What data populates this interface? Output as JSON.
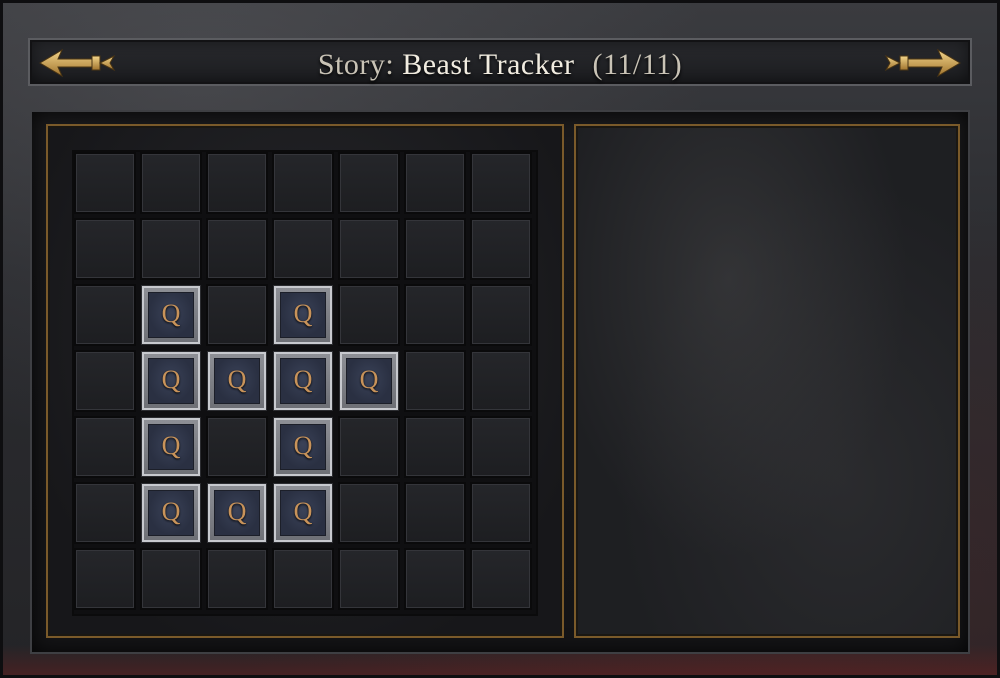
{
  "header": {
    "title_prefix": "Story:",
    "title_name": "Beast Tracker",
    "title_count": "(11/11)",
    "prev_icon": "ornate-arrow-left-icon",
    "next_icon": "ornate-arrow-right-icon"
  },
  "grid": {
    "rows": 7,
    "cols": 7,
    "quest_glyph": "Q",
    "filled_cells": [
      [
        2,
        1
      ],
      [
        2,
        3
      ],
      [
        3,
        1
      ],
      [
        3,
        2
      ],
      [
        3,
        3
      ],
      [
        3,
        4
      ],
      [
        4,
        1
      ],
      [
        4,
        3
      ],
      [
        5,
        1
      ],
      [
        5,
        2
      ],
      [
        5,
        3
      ]
    ]
  },
  "colors": {
    "accent_gold": "#7a5a2a",
    "glyph": "#c8935a",
    "title_text": "#f1ece0"
  }
}
